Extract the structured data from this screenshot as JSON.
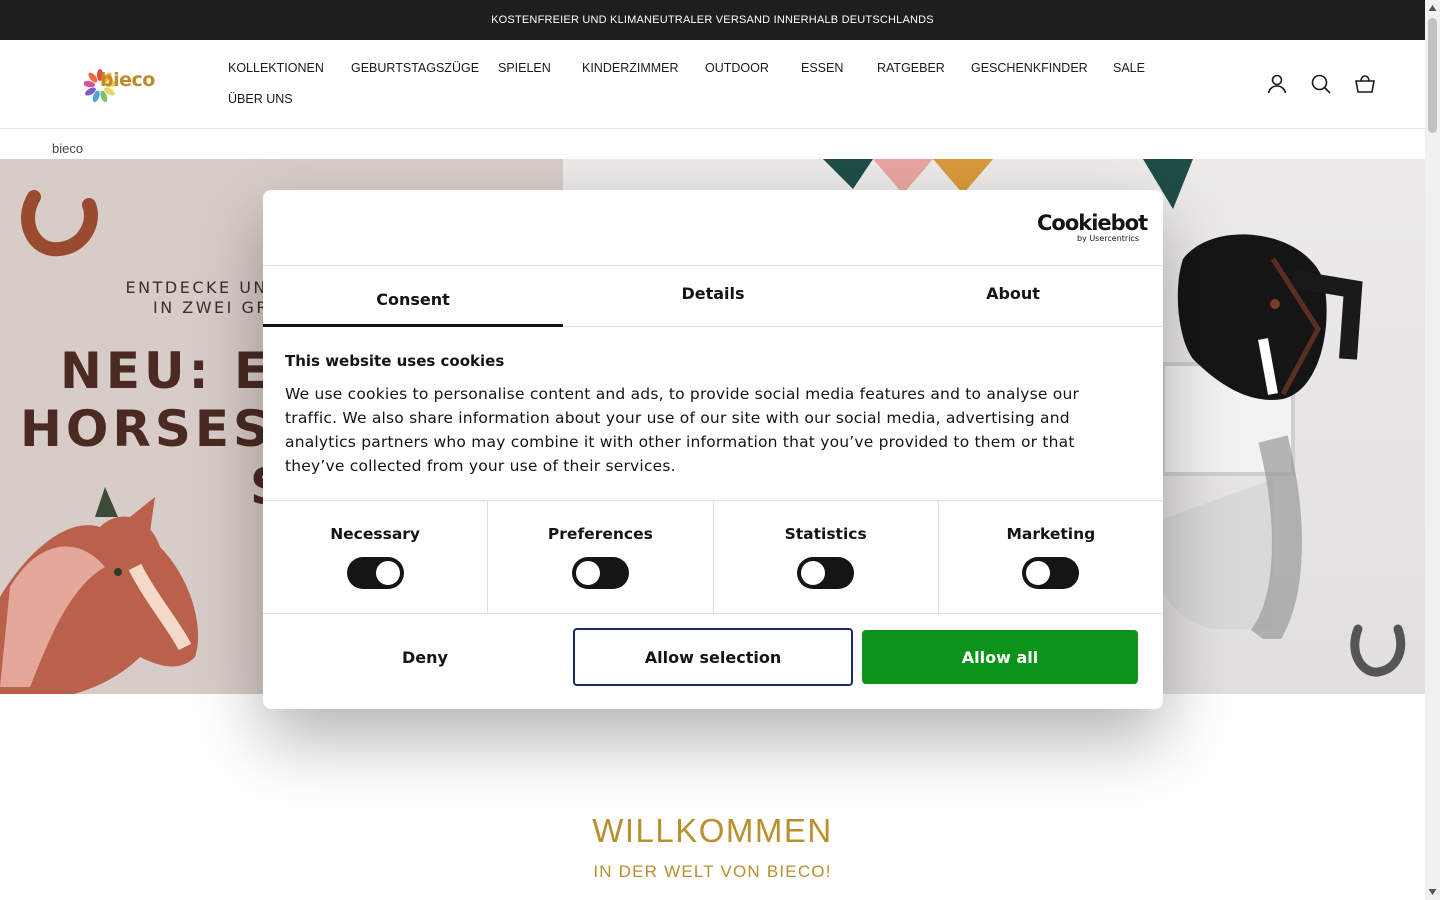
{
  "announcement": "KOSTENFREIER UND KLIMANEUTRALER VERSAND INNERHALB DEUTSCHLANDS",
  "header": {
    "logo_text": "bieco",
    "nav": [
      "KOLLEKTIONEN",
      "GEBURTSTAGSZÜGE",
      "SPIELEN",
      "KINDERZIMMER",
      "OUTDOOR",
      "ESSEN",
      "RATGEBER",
      "GESCHENKFINDER",
      "SALE",
      "ÜBER UNS"
    ],
    "icons": [
      "account-icon",
      "search-icon",
      "cart-icon"
    ]
  },
  "breadcrumb": "bieco",
  "hero": {
    "kicker_line1": "ENTDECKE UNS",
    "kicker_line2": "IN ZWEI GRÖ",
    "headline_line1": "NEU: EC",
    "headline_line2": "HORSES",
    "headline_line3": "S"
  },
  "welcome": {
    "title": "WILLKOMMEN",
    "subtitle": "IN DER WELT VON BIECO!"
  },
  "cookie_dialog": {
    "brand": "Cookiebot",
    "brand_sub": "by Usercentrics",
    "tabs": [
      "Consent",
      "Details",
      "About"
    ],
    "active_tab": "Consent",
    "title": "This website uses cookies",
    "text": "We use cookies to personalise content and ads, to provide social media features and to analyse our traffic. We also share information about your use of our site with our social media, advertising and analytics partners who may combine it with other information that you’ve provided to them or that they’ve collected from your use of their services.",
    "toggles": [
      {
        "label": "Necessary",
        "on": true
      },
      {
        "label": "Preferences",
        "on": false
      },
      {
        "label": "Statistics",
        "on": false
      },
      {
        "label": "Marketing",
        "on": false
      }
    ],
    "buttons": {
      "deny": "Deny",
      "allow_selection": "Allow selection",
      "allow_all": "Allow all"
    },
    "colors": {
      "allow_all_bg": "#0c941a",
      "selection_border": "#1a2a6c",
      "toggle_bg": "#141414"
    }
  },
  "colors": {
    "brand_gold": "#b8902e",
    "topbar": "#1e1e1e"
  }
}
